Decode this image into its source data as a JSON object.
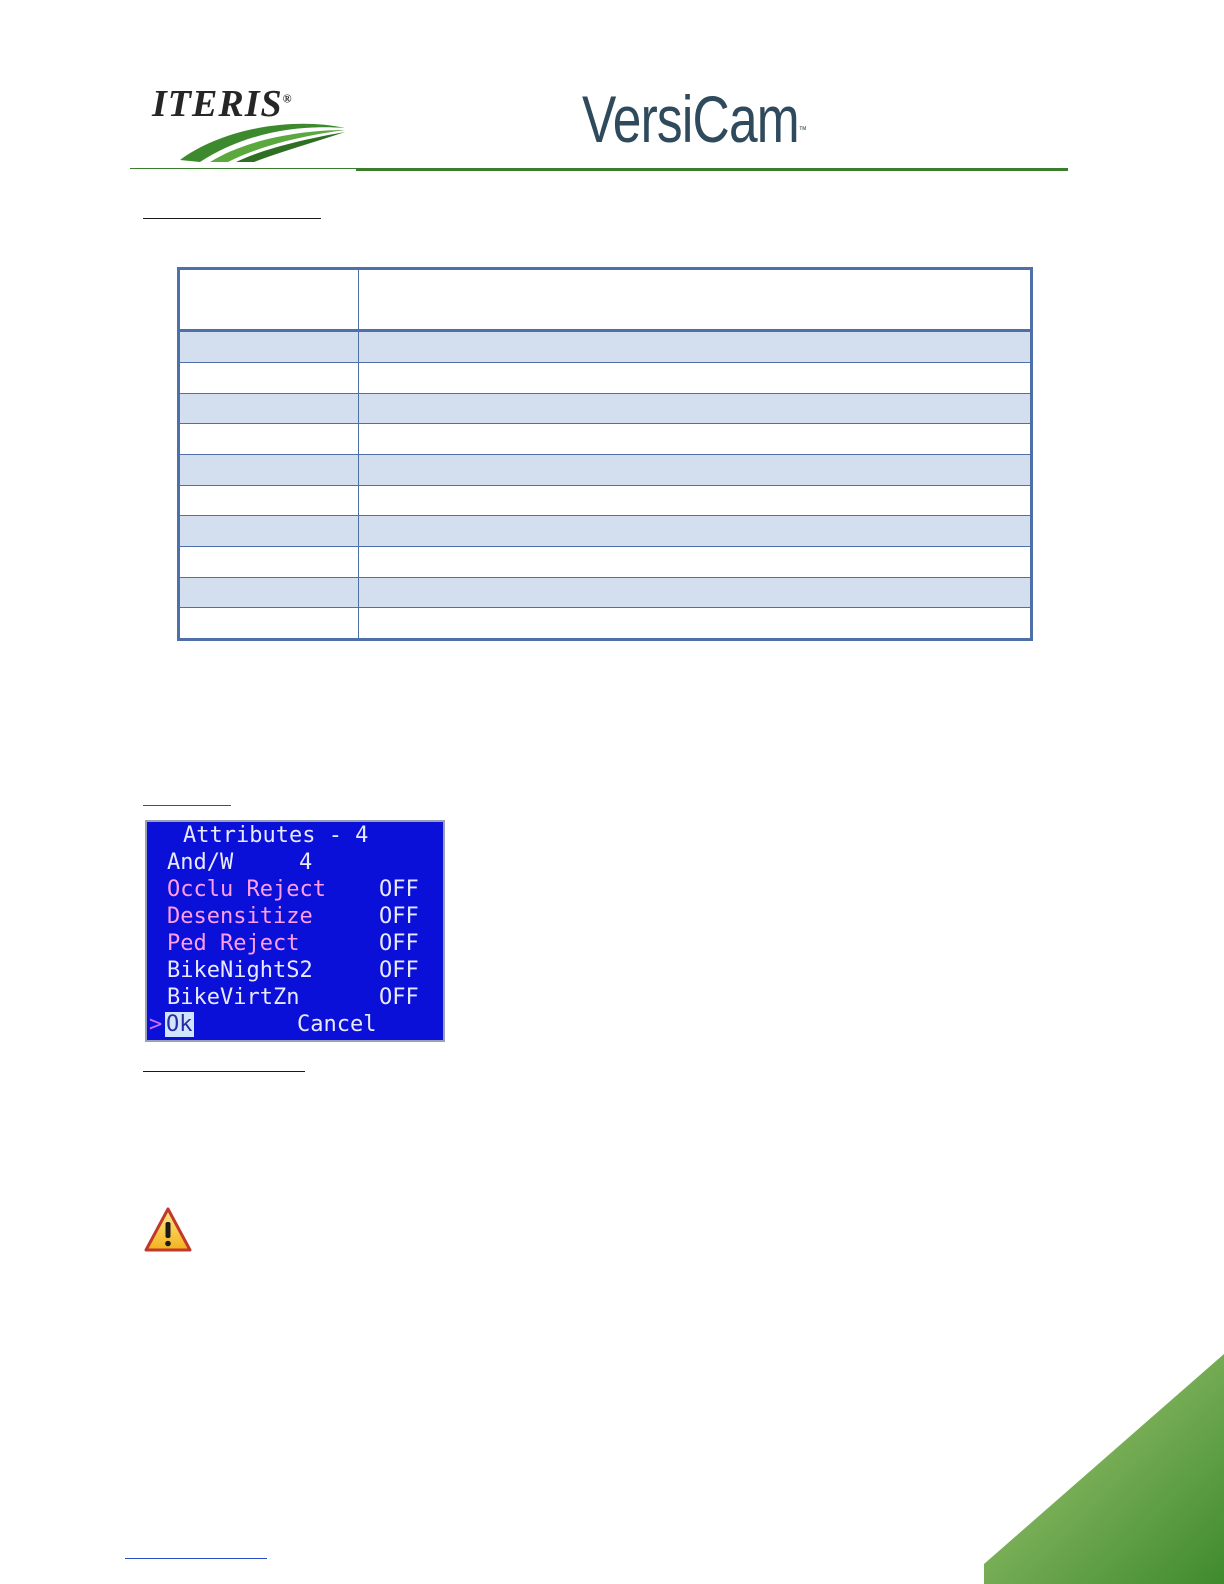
{
  "header": {
    "logo_text": "ITERIS",
    "logo_reg": "®",
    "product_name": "VersiCam",
    "product_tm": "™"
  },
  "table": {
    "header": [
      "",
      ""
    ],
    "rows": [
      [
        "",
        ""
      ],
      [
        "",
        ""
      ],
      [
        "",
        ""
      ],
      [
        "",
        ""
      ],
      [
        "",
        ""
      ],
      [
        "",
        ""
      ],
      [
        "",
        ""
      ],
      [
        "",
        ""
      ],
      [
        "",
        ""
      ],
      [
        "",
        ""
      ]
    ]
  },
  "osd": {
    "title": "Attributes - 4",
    "items": [
      {
        "label": "And/W",
        "value": "4"
      },
      {
        "label": "Occlu Reject",
        "value": "OFF"
      },
      {
        "label": "Desensitize",
        "value": "OFF"
      },
      {
        "label": "Ped Reject",
        "value": "OFF"
      },
      {
        "label": "BikeNightS2",
        "value": "OFF"
      },
      {
        "label": "BikeVirtZn",
        "value": "OFF"
      }
    ],
    "cursor": ">",
    "ok_label": "Ok",
    "cancel_label": "Cancel"
  },
  "colors": {
    "brand_green": "#3a7d2c",
    "table_border": "#4f6fa8",
    "table_shade": "#d3deee",
    "osd_background": "#0a10d8"
  },
  "icons": {
    "warning": "warning-triangle-icon"
  }
}
